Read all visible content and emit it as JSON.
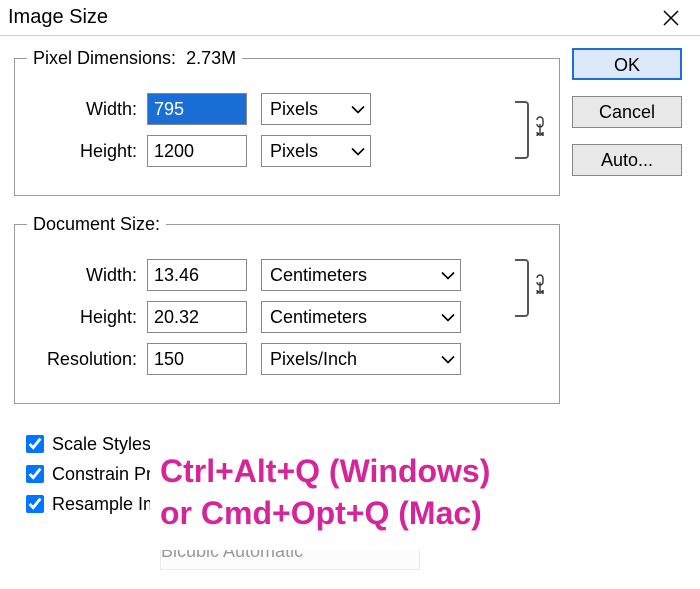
{
  "title": "Image Size",
  "buttons": {
    "ok": "OK",
    "cancel": "Cancel",
    "auto": "Auto..."
  },
  "pixel": {
    "legend": "Pixel Dimensions:",
    "size": "2.73M",
    "width_label": "Width:",
    "width_value": "795",
    "width_unit": "Pixels",
    "height_label": "Height:",
    "height_value": "1200",
    "height_unit": "Pixels"
  },
  "doc": {
    "legend": "Document Size:",
    "width_label": "Width:",
    "width_value": "13.46",
    "width_unit": "Centimeters",
    "height_label": "Height:",
    "height_value": "20.32",
    "height_unit": "Centimeters",
    "res_label": "Resolution:",
    "res_value": "150",
    "res_unit": "Pixels/Inch"
  },
  "checks": {
    "scale": "Scale Styles",
    "constrain": "Constrain Pr",
    "resample": "Resample Im",
    "ghost": "Bicubic Automatic"
  },
  "overlay": {
    "line1": "Ctrl+Alt+Q (Windows)",
    "line2": "or Cmd+Opt+Q (Mac)"
  }
}
